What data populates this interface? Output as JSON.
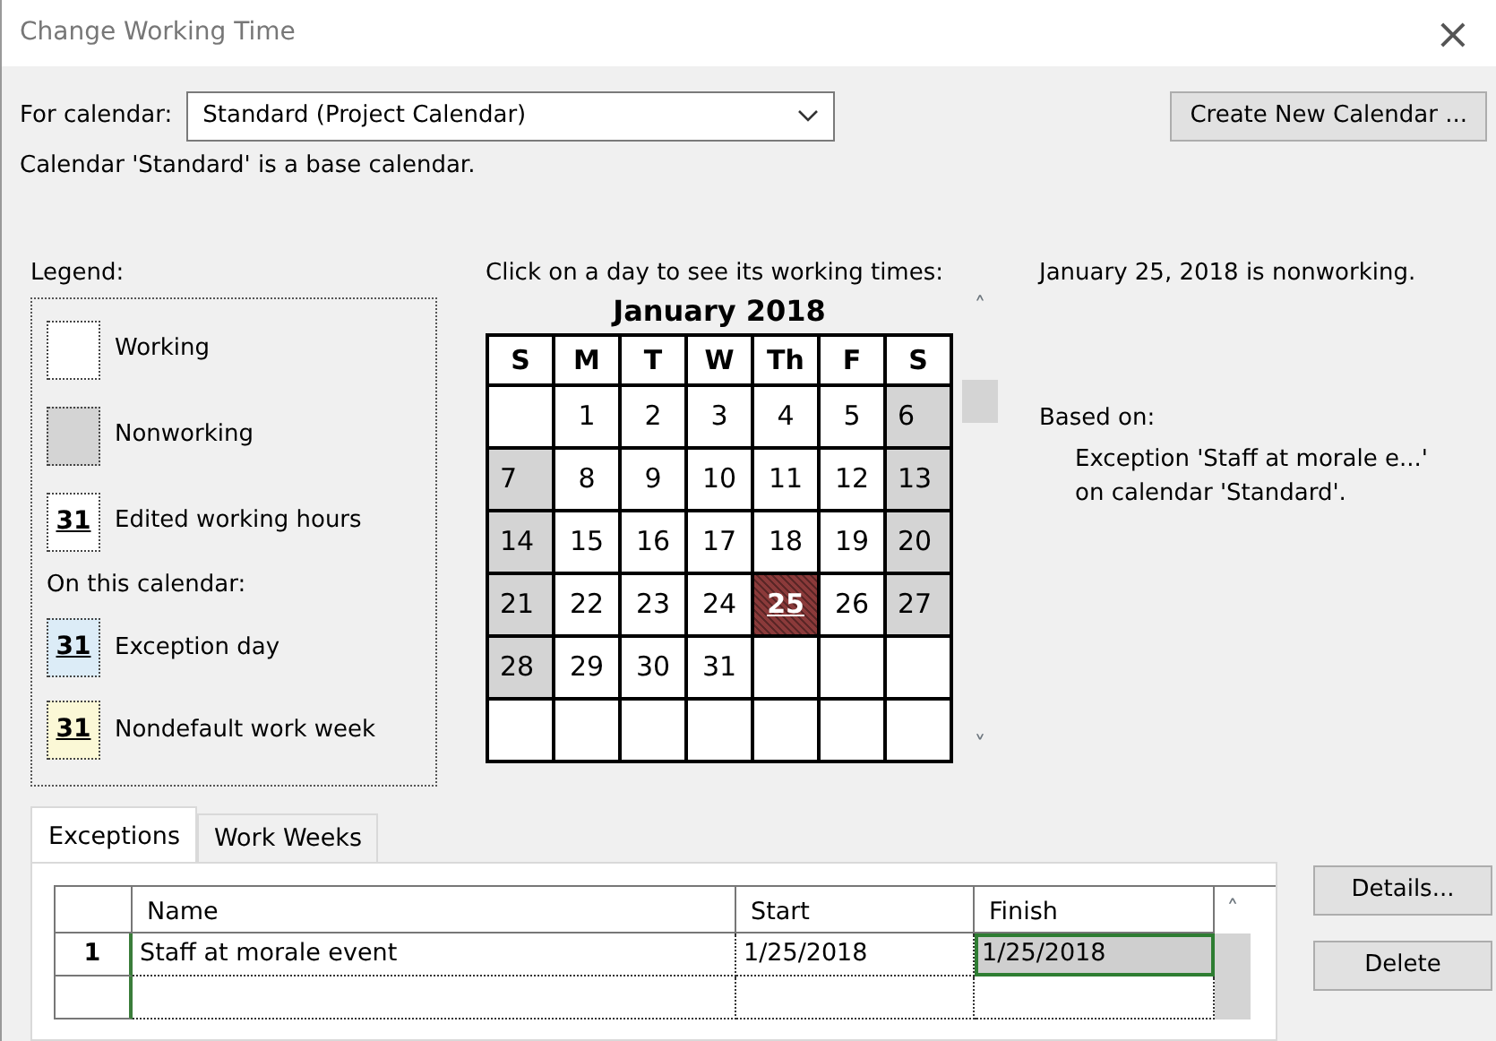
{
  "window": {
    "title": "Change Working Time",
    "close": "×"
  },
  "for_calendar": {
    "label": "For calendar:",
    "value": "Standard (Project Calendar)"
  },
  "create_button": "Create New Calendar ...",
  "base_note": "Calendar 'Standard' is a base calendar.",
  "legend": {
    "title": "Legend:",
    "subtitle": "On this calendar:",
    "items": [
      {
        "kind": "working",
        "label": "Working"
      },
      {
        "kind": "nonworking",
        "label": "Nonworking"
      },
      {
        "kind": "edited",
        "glyph": "31",
        "label": "Edited working hours"
      },
      {
        "kind": "exception",
        "glyph": "31",
        "label": "Exception day"
      },
      {
        "kind": "nondefault",
        "glyph": "31",
        "label": "Nondefault work week"
      }
    ]
  },
  "calendar": {
    "prompt": "Click on a day to see its working times:",
    "month": "January 2018",
    "up": "˄",
    "down": "˅",
    "weekdays": [
      "S",
      "M",
      "T",
      "W",
      "Th",
      "F",
      "S"
    ],
    "weeks": [
      [
        {
          "kind": "working",
          "selected": false
        },
        {
          "text": "1",
          "kind": "working",
          "selected": false
        },
        {
          "text": "2",
          "kind": "working",
          "selected": false
        },
        {
          "text": "3",
          "kind": "working",
          "selected": false
        },
        {
          "text": "4",
          "kind": "working",
          "selected": false
        },
        {
          "text": "5",
          "kind": "working",
          "selected": false
        },
        {
          "text": "6",
          "kind": "nonworking",
          "selected": false
        }
      ],
      [
        {
          "text": "7",
          "kind": "nonworking",
          "selected": false
        },
        {
          "text": "8",
          "kind": "working",
          "selected": false
        },
        {
          "text": "9",
          "kind": "working",
          "selected": false
        },
        {
          "text": "10",
          "kind": "working",
          "selected": false
        },
        {
          "text": "11",
          "kind": "working",
          "selected": false
        },
        {
          "text": "12",
          "kind": "working",
          "selected": false
        },
        {
          "text": "13",
          "kind": "nonworking",
          "selected": false
        }
      ],
      [
        {
          "text": "14",
          "kind": "nonworking",
          "selected": false
        },
        {
          "text": "15",
          "kind": "working",
          "selected": false
        },
        {
          "text": "16",
          "kind": "working",
          "selected": false
        },
        {
          "text": "17",
          "kind": "working",
          "selected": false
        },
        {
          "text": "18",
          "kind": "working",
          "selected": false
        },
        {
          "text": "19",
          "kind": "working",
          "selected": false
        },
        {
          "text": "20",
          "kind": "nonworking",
          "selected": false
        }
      ],
      [
        {
          "text": "21",
          "kind": "nonworking",
          "selected": false
        },
        {
          "text": "22",
          "kind": "working",
          "selected": false
        },
        {
          "text": "23",
          "kind": "working",
          "selected": false
        },
        {
          "text": "24",
          "kind": "working",
          "selected": false
        },
        {
          "text": "25",
          "kind": "exception",
          "selected": true
        },
        {
          "text": "26",
          "kind": "working",
          "selected": false
        },
        {
          "text": "27",
          "kind": "nonworking",
          "selected": false
        }
      ],
      [
        {
          "text": "28",
          "kind": "nonworking",
          "selected": false
        },
        {
          "text": "29",
          "kind": "working",
          "selected": false
        },
        {
          "text": "30",
          "kind": "working",
          "selected": false
        },
        {
          "text": "31",
          "kind": "working",
          "selected": false
        },
        {
          "kind": "working",
          "selected": false
        },
        {
          "kind": "working",
          "selected": false
        },
        {
          "kind": "working",
          "selected": false
        }
      ],
      [
        {
          "kind": "working",
          "selected": false
        },
        {
          "kind": "working",
          "selected": false
        },
        {
          "kind": "working",
          "selected": false
        },
        {
          "kind": "working",
          "selected": false
        },
        {
          "kind": "working",
          "selected": false
        },
        {
          "kind": "working",
          "selected": false
        },
        {
          "kind": "working",
          "selected": false
        }
      ]
    ]
  },
  "info": {
    "status": "January 25, 2018 is nonworking.",
    "based_on": "Based on:",
    "detail": [
      "Exception 'Staff at morale e...'",
      "on calendar 'Standard'."
    ]
  },
  "tabs": [
    {
      "label": "Exceptions",
      "selected": true
    },
    {
      "label": "Work Weeks",
      "selected": false
    }
  ],
  "table": {
    "columns": [
      "Name",
      "Start",
      "Finish"
    ],
    "up": "˄",
    "rows": [
      {
        "number": "1",
        "cells": [
          {
            "text": "Staff at morale event",
            "selected": false
          },
          {
            "text": "1/25/2018",
            "selected": false
          },
          {
            "text": "1/25/2018",
            "selected": true
          }
        ]
      }
    ]
  },
  "buttons": [
    "Details...",
    "Delete"
  ]
}
